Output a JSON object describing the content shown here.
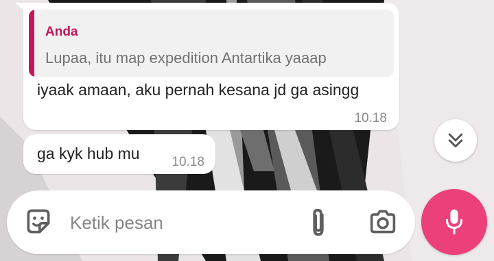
{
  "chat": {
    "messages": [
      {
        "quote": {
          "author": "Anda",
          "text": "Lupaa, itu map expedition Antartika yaaap"
        },
        "text": "iyaak amaan, aku pernah kesana jd ga asingg",
        "time": "10.18"
      },
      {
        "text": "ga kyk hub mu",
        "time": "10.18"
      }
    ]
  },
  "composer": {
    "placeholder": "Ketik pesan",
    "value": ""
  },
  "icons": {
    "sticker": "sticker-icon",
    "attach": "paperclip-icon",
    "camera": "camera-icon",
    "mic": "microphone-icon",
    "scroll_down": "double-chevron-down-icon"
  },
  "colors": {
    "quote_accent": "#c2185b",
    "mic_button": "#ec407a",
    "bubble": "#ffffff",
    "timestamp": "#8a8a8a"
  }
}
